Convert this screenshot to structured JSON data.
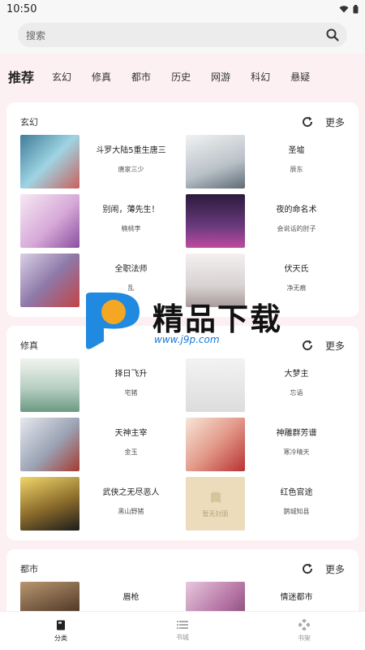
{
  "status": {
    "time": "10:50"
  },
  "search": {
    "placeholder": "搜索"
  },
  "tabs": [
    "推荐",
    "玄幻",
    "修真",
    "都市",
    "历史",
    "网游",
    "科幻",
    "悬疑"
  ],
  "sections": [
    {
      "title": "玄幻",
      "more": "更多",
      "books": [
        {
          "title": "斗罗大陆5重生唐三",
          "author": "唐家三少",
          "cover_color": "#6fb0c8"
        },
        {
          "title": "圣墟",
          "author": "辰东",
          "cover_color": "#cfd4d8"
        },
        {
          "title": "别闹，薄先生！",
          "author": "楠桃李",
          "cover_color": "#e7c3df"
        },
        {
          "title": "夜的命名术",
          "author": "会说话的肘子",
          "cover_color": "#4a2a5e"
        },
        {
          "title": "全职法师",
          "author": "乱",
          "cover_color": "#b6a6c6"
        },
        {
          "title": "伏天氏",
          "author": "净无痕",
          "cover_color": "#e8e4e4"
        }
      ]
    },
    {
      "title": "修真",
      "more": "更多",
      "books": [
        {
          "title": "择日飞升",
          "author": "宅猪",
          "cover_color": "#a9c4b8"
        },
        {
          "title": "大梦主",
          "author": "忘语",
          "cover_color": "#e9e9e9"
        },
        {
          "title": "天神主宰",
          "author": "金玉",
          "cover_color": "#c4c8d2"
        },
        {
          "title": "神雕群芳谱",
          "author": "寒冷晴天",
          "cover_color": "#d96a6a"
        },
        {
          "title": "武侠之无尽恶人",
          "author": "黑山野猪",
          "cover_color": "#d4b445"
        },
        {
          "title": "红色官途",
          "author": "鹅城知县",
          "cover_color": "#ecdcbc"
        }
      ]
    },
    {
      "title": "都市",
      "more": "更多",
      "books": [
        {
          "title": "眉枪",
          "author": "",
          "cover_color": "#8a6a4a"
        },
        {
          "title": "情迷都市",
          "author": "",
          "cover_color": "#c07cae"
        }
      ]
    }
  ],
  "no_cover_text": "暂无封面",
  "watermark": {
    "brand": "精品下载",
    "url": "www.j9p.com"
  },
  "bottom_nav": [
    "分类",
    "书城",
    "书架"
  ]
}
